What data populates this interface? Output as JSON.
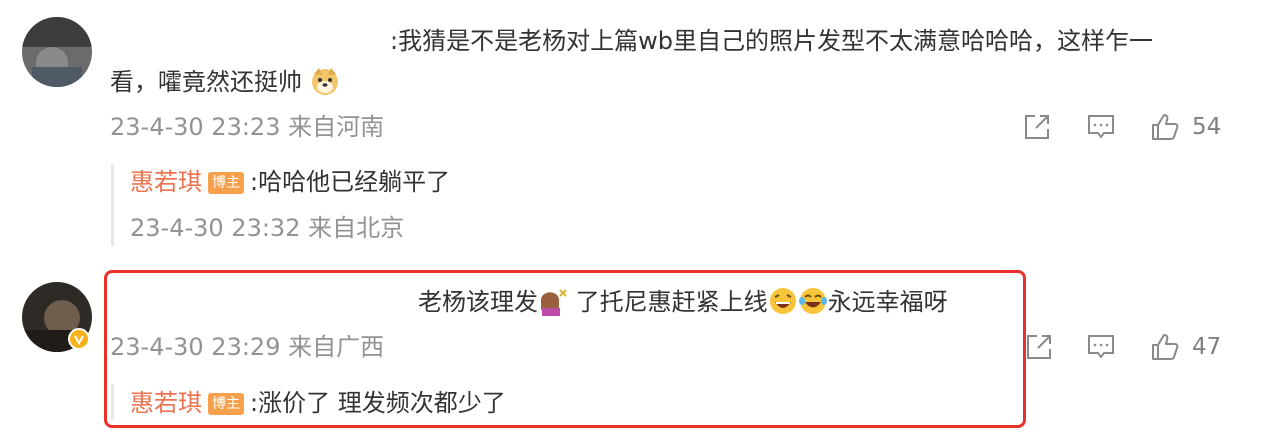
{
  "comments": [
    {
      "text_line1": ":我猜是不是老杨对上篇wb里自己的照片发型不太满意哈哈哈，这样乍一",
      "text_line2": "看，嚯竟然还挺帅",
      "emoji": "doge-emoji",
      "time": "23-4-30 23:23 来自河南",
      "likes": "54",
      "reply": {
        "name": "惠若琪",
        "badge": "博主",
        "text": ":哈哈他已经躺平了",
        "time": "23-4-30 23:32 来自北京"
      }
    },
    {
      "text_a": "老杨该理发",
      "text_b": " 了托尼惠赶紧上线",
      "text_c": "永远幸福呀",
      "time": "23-4-30 23:29 来自广西",
      "likes": "47",
      "reply": {
        "name": "惠若琪",
        "badge": "博主",
        "text": ":涨价了 理发频次都少了"
      }
    }
  ],
  "icons": [
    "share-icon",
    "comment-icon",
    "like-icon"
  ],
  "colors": {
    "highlight_border": "#e8312b",
    "name": "#eb7350",
    "badge": "#f6a04c",
    "meta": "#939393"
  }
}
